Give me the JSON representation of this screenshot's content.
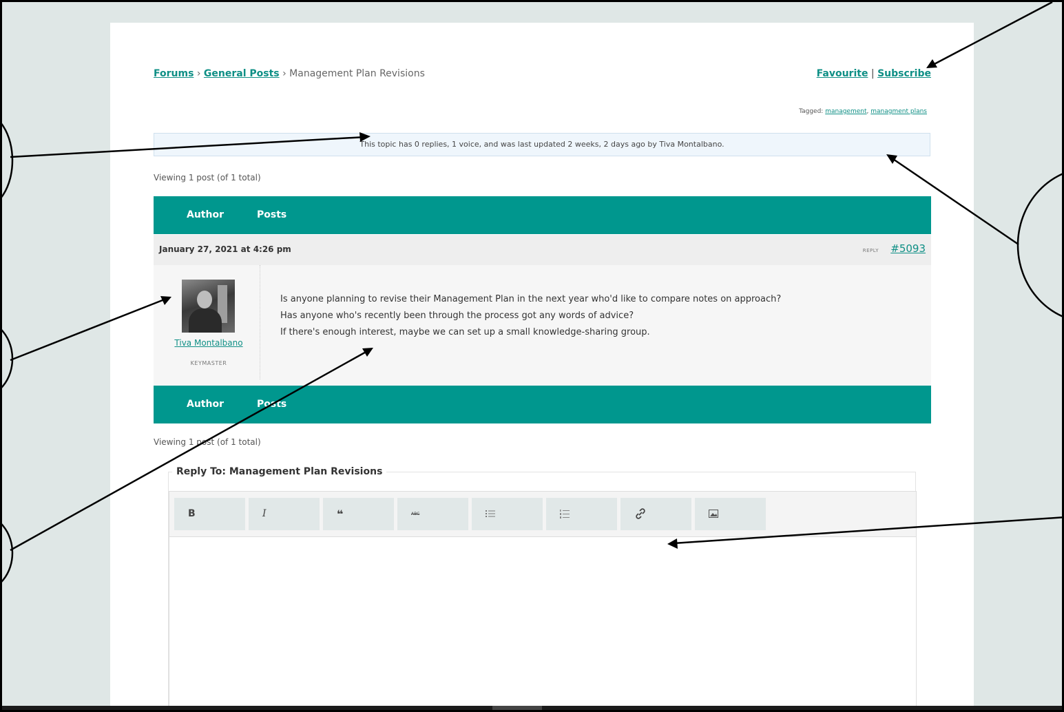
{
  "breadcrumb": {
    "forums": "Forums",
    "sep1": "›",
    "general_posts": "General Posts",
    "sep2": "›",
    "current": "Management Plan Revisions"
  },
  "topic_actions": {
    "favourite": "Favourite",
    "sep": "|",
    "subscribe": "Subscribe"
  },
  "tags": {
    "label": "Tagged:",
    "items": [
      "management",
      "managment plans"
    ],
    "sep": ","
  },
  "notice": "This topic has 0 replies, 1 voice, and was last updated 2 weeks, 2 days ago by Tiva Montalbano.",
  "pagination": "Viewing 1 post (of 1 total)",
  "table_header": {
    "author": "Author",
    "posts": "Posts"
  },
  "post": {
    "date": "January 27, 2021 at 4:26 pm",
    "reply_label": "REPLY",
    "id": "#5093",
    "author": {
      "name": "Tiva Montalbano",
      "role": "KEYMASTER"
    },
    "lines": [
      "Is anyone planning to revise their Management Plan in the next year who'd like to compare notes on approach?",
      "Has anyone who's recently been through the process got any words of advice?",
      "If there's enough interest, maybe we can set up a small knowledge-sharing group."
    ]
  },
  "reply_form": {
    "legend": "Reply To: Management Plan Revisions",
    "toolbar": {
      "bold": "B",
      "italic": "I",
      "quote": "❝",
      "strike": "ABC"
    }
  },
  "icons": {
    "bold": "bold-icon",
    "italic": "italic-icon",
    "quote": "quote-icon",
    "strike": "strikethrough-icon",
    "bullet_list": "bulleted-list-icon",
    "numbered_list": "numbered-list-icon",
    "link": "link-icon",
    "image": "image-icon"
  },
  "colors": {
    "accent": "#00978e",
    "link": "#0e8f85",
    "page_bg": "#dfe7e6",
    "notice_bg": "#eff6fc"
  }
}
